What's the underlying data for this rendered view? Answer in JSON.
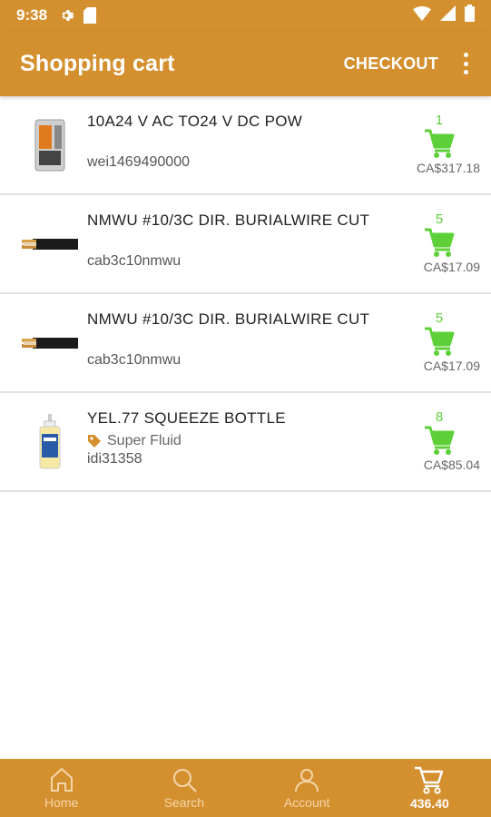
{
  "status": {
    "time": "9:38"
  },
  "appbar": {
    "title": "Shopping cart",
    "checkout": "CHECKOUT"
  },
  "items": [
    {
      "name": "10A24 V AC TO24 V DC POW",
      "sku": "wei1469490000",
      "brand": "",
      "qty": "1",
      "price": "CA$317.18"
    },
    {
      "name": "NMWU #10/3C  DIR. BURIALWIRE CUT",
      "sku": "cab3c10nmwu",
      "brand": "",
      "qty": "5",
      "price": "CA$17.09"
    },
    {
      "name": "NMWU #10/3C  DIR. BURIALWIRE CUT",
      "sku": "cab3c10nmwu",
      "brand": "",
      "qty": "5",
      "price": "CA$17.09"
    },
    {
      "name": "YEL.77 SQUEEZE BOTTLE",
      "sku": "idi31358",
      "brand": "Super Fluid",
      "qty": "8",
      "price": "CA$85.04"
    }
  ],
  "nav": {
    "home": "Home",
    "search": "Search",
    "account": "Account",
    "cart_total": "436.40"
  },
  "colors": {
    "accent": "#D4902F",
    "cart_green": "#5DD039"
  }
}
